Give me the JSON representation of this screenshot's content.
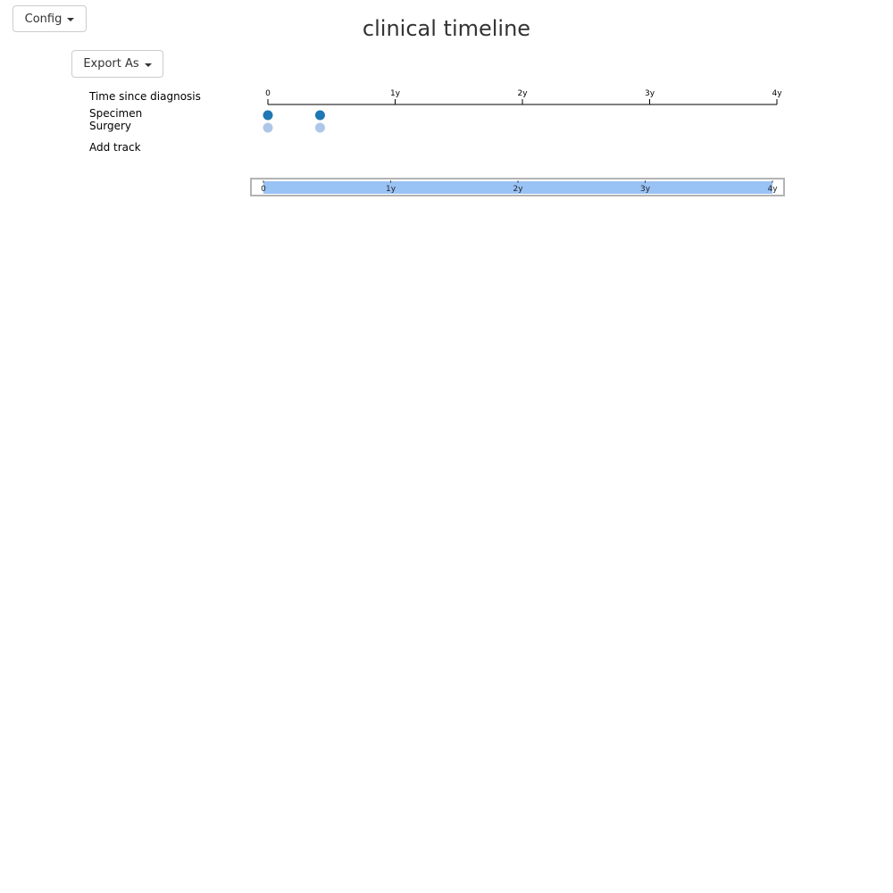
{
  "toolbar": {
    "config_label": "Config",
    "export_label": "Export As"
  },
  "title": "clinical timeline",
  "tracks": {
    "axis_label": "Time since diagnosis",
    "items": [
      {
        "label": "Specimen",
        "color": "#1f77b4",
        "events_years": [
          0,
          0.41
        ]
      },
      {
        "label": "Surgery",
        "color": "#aec7e8",
        "events_years": [
          0,
          0.41
        ]
      }
    ],
    "add_track_label": "Add track"
  },
  "axis": {
    "ticks": [
      {
        "value": 0,
        "label": "0"
      },
      {
        "value": 1,
        "label": "1y"
      },
      {
        "value": 2,
        "label": "2y"
      },
      {
        "value": 3,
        "label": "3y"
      },
      {
        "value": 4,
        "label": "4y"
      }
    ],
    "domain": [
      0,
      4
    ]
  },
  "overview": {
    "brush_range_years": [
      0,
      4
    ],
    "brush_color": "#99c2f5"
  }
}
